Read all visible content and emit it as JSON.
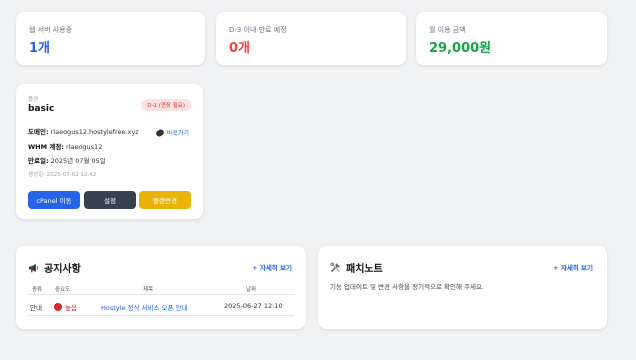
{
  "stats": [
    {
      "label": "웹 서버 사용중",
      "value": "1개",
      "color": "#2563eb"
    },
    {
      "label": "D-3 이내 만료 예정",
      "value": "0개",
      "color": "#ef4444"
    },
    {
      "label": "월 이용 금액",
      "value": "29,000원",
      "color": "#16a34a"
    }
  ],
  "plan": {
    "kicker": "플랜",
    "name": "basic",
    "badge": "D-1 (연장 필요)",
    "domain_label": "도메인:",
    "domain_value": "rlaeogus12.hostylefree.xyz",
    "goto_label": "바로가기",
    "whm_label": "WHM 계정:",
    "whm_value": "rlaeogus12",
    "expiry_label": "만료일:",
    "expiry_value": "2025년 07월 05일",
    "created": "생성일: 2025-07-02 12:42",
    "buttons": {
      "cpanel": "cPanel 이동",
      "settings": "설정",
      "change_plan": "플랜변경"
    }
  },
  "notice": {
    "title": "공지사항",
    "more": "+ 자세히 보기",
    "columns": [
      "종류",
      "중요도",
      "제목",
      "날짜"
    ],
    "rows": [
      {
        "type": "안내",
        "priority": "높음",
        "title_prefix": "Hostyle",
        "title_rest": " 정식 서비스 오픈 안내",
        "date": "2025-06-27 12:10"
      }
    ]
  },
  "patch": {
    "title": "패치노트",
    "more": "+ 자세히 보기",
    "text": "기능 업데이트 및 변경 사항을 정기적으로 확인해 주세요."
  },
  "colors": {
    "accent": "#2563eb",
    "danger": "#ef4444",
    "success": "#16a34a",
    "warning": "#eab308"
  }
}
